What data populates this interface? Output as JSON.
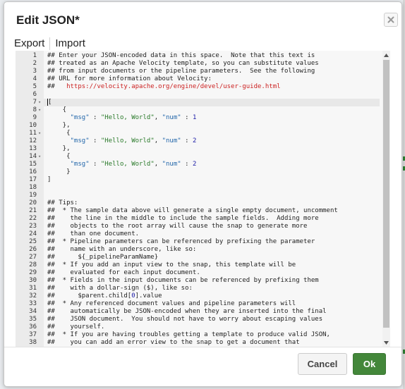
{
  "dialog": {
    "title": "Edit JSON*",
    "close_icon": "close-icon"
  },
  "tabs": [
    {
      "label": "Export"
    },
    {
      "label": "Import"
    }
  ],
  "editor": {
    "active_line": 7,
    "lines": [
      {
        "n": "1",
        "fold": "",
        "segs": [
          [
            "c",
            "## Enter your JSON-encoded data in this space.  Note that this text is"
          ]
        ]
      },
      {
        "n": "2",
        "fold": "",
        "segs": [
          [
            "c",
            "## treated as an Apache Velocity template, so you can substitute values"
          ]
        ]
      },
      {
        "n": "3",
        "fold": "",
        "segs": [
          [
            "c",
            "## from input documents or the pipeline parameters.  See the following"
          ]
        ]
      },
      {
        "n": "4",
        "fold": "",
        "segs": [
          [
            "c",
            "## URL for more information about Velocity:"
          ]
        ]
      },
      {
        "n": "5",
        "fold": "",
        "segs": [
          [
            "c",
            "##   "
          ],
          [
            "link",
            "https://velocity.apache.org/engine/devel/user-guide.html"
          ]
        ]
      },
      {
        "n": "6",
        "fold": "",
        "segs": []
      },
      {
        "n": "7",
        "fold": "▾",
        "segs": [
          [
            "p",
            "["
          ]
        ]
      },
      {
        "n": "8",
        "fold": "▾",
        "segs": [
          [
            "p",
            "    {"
          ]
        ]
      },
      {
        "n": "9",
        "fold": "",
        "segs": [
          [
            "p",
            "      "
          ],
          [
            "key",
            "\"msg\""
          ],
          [
            "p",
            " : "
          ],
          [
            "str",
            "\"Hello, World\""
          ],
          [
            "p",
            ", "
          ],
          [
            "key",
            "\"num\""
          ],
          [
            "p",
            " : "
          ],
          [
            "num",
            "1"
          ]
        ]
      },
      {
        "n": "10",
        "fold": "",
        "segs": [
          [
            "p",
            "    },"
          ]
        ]
      },
      {
        "n": "11",
        "fold": "▾",
        "segs": [
          [
            "p",
            "     {"
          ]
        ]
      },
      {
        "n": "12",
        "fold": "",
        "segs": [
          [
            "p",
            "      "
          ],
          [
            "key",
            "\"msg\""
          ],
          [
            "p",
            " : "
          ],
          [
            "str",
            "\"Hello, World\""
          ],
          [
            "p",
            ", "
          ],
          [
            "key",
            "\"num\""
          ],
          [
            "p",
            " : "
          ],
          [
            "num",
            "2"
          ]
        ]
      },
      {
        "n": "13",
        "fold": "",
        "segs": [
          [
            "p",
            "    },"
          ]
        ]
      },
      {
        "n": "14",
        "fold": "▾",
        "segs": [
          [
            "p",
            "     {"
          ]
        ]
      },
      {
        "n": "15",
        "fold": "",
        "segs": [
          [
            "p",
            "      "
          ],
          [
            "key",
            "\"msg\""
          ],
          [
            "p",
            " : "
          ],
          [
            "str",
            "\"Hello, World\""
          ],
          [
            "p",
            ", "
          ],
          [
            "key",
            "\"num\""
          ],
          [
            "p",
            " : "
          ],
          [
            "num",
            "2"
          ]
        ]
      },
      {
        "n": "16",
        "fold": "",
        "segs": [
          [
            "p",
            "     }"
          ]
        ]
      },
      {
        "n": "17",
        "fold": "",
        "segs": [
          [
            "p",
            "]"
          ]
        ]
      },
      {
        "n": "18",
        "fold": "",
        "segs": []
      },
      {
        "n": "19",
        "fold": "",
        "segs": []
      },
      {
        "n": "20",
        "fold": "",
        "segs": [
          [
            "c",
            "## Tips:"
          ]
        ]
      },
      {
        "n": "21",
        "fold": "",
        "segs": [
          [
            "c",
            "##  * The sample data above will generate a single empty document, uncomment"
          ]
        ]
      },
      {
        "n": "22",
        "fold": "",
        "segs": [
          [
            "c",
            "##    the line in the middle to include the sample fields.  Adding more"
          ]
        ]
      },
      {
        "n": "23",
        "fold": "",
        "segs": [
          [
            "c",
            "##    objects to the root array will cause the snap to generate more"
          ]
        ]
      },
      {
        "n": "24",
        "fold": "",
        "segs": [
          [
            "c",
            "##    than one document."
          ]
        ]
      },
      {
        "n": "25",
        "fold": "",
        "segs": [
          [
            "c",
            "##  * Pipeline parameters can be referenced by prefixing the parameter"
          ]
        ]
      },
      {
        "n": "26",
        "fold": "",
        "segs": [
          [
            "c",
            "##    name with an underscore, like so:"
          ]
        ]
      },
      {
        "n": "27",
        "fold": "",
        "segs": [
          [
            "c",
            "##      ${_pipelineParamName}"
          ]
        ]
      },
      {
        "n": "28",
        "fold": "",
        "segs": [
          [
            "c",
            "##  * If you add an input view to the snap, this template will be"
          ]
        ]
      },
      {
        "n": "29",
        "fold": "",
        "segs": [
          [
            "c",
            "##    evaluated for each input document."
          ]
        ]
      },
      {
        "n": "30",
        "fold": "",
        "segs": [
          [
            "c",
            "##  * Fields in the input documents can be referenced by prefixing them"
          ]
        ]
      },
      {
        "n": "31",
        "fold": "",
        "segs": [
          [
            "c",
            "##    with a dollar-sign ($), like so:"
          ]
        ]
      },
      {
        "n": "32",
        "fold": "",
        "segs": [
          [
            "c",
            "##      $parent.child["
          ],
          [
            "num",
            "0"
          ],
          [
            "c",
            "].value"
          ]
        ]
      },
      {
        "n": "33",
        "fold": "",
        "segs": [
          [
            "c",
            "##  * Any referenced document values and pipeline parameters will"
          ]
        ]
      },
      {
        "n": "34",
        "fold": "",
        "segs": [
          [
            "c",
            "##    automatically be JSON-encoded when they are inserted into the final"
          ]
        ]
      },
      {
        "n": "35",
        "fold": "",
        "segs": [
          [
            "c",
            "##    JSON document.  You should not have to worry about escaping values"
          ]
        ]
      },
      {
        "n": "36",
        "fold": "",
        "segs": [
          [
            "c",
            "##    yourself."
          ]
        ]
      },
      {
        "n": "37",
        "fold": "",
        "segs": [
          [
            "c",
            "##  * If you are having troubles getting a template to produce valid JSON,"
          ]
        ]
      },
      {
        "n": "38",
        "fold": "",
        "segs": [
          [
            "c",
            "##    you can add an error view to the snap to get a document that"
          ]
        ]
      }
    ]
  },
  "footer": {
    "cancel_label": "Cancel",
    "ok_label": "Ok"
  },
  "colors": {
    "ok_button": "#43873a",
    "link": "#cc2222",
    "json_key": "#2266aa",
    "json_string": "#2a7a2a",
    "json_number": "#1a1aa6"
  }
}
